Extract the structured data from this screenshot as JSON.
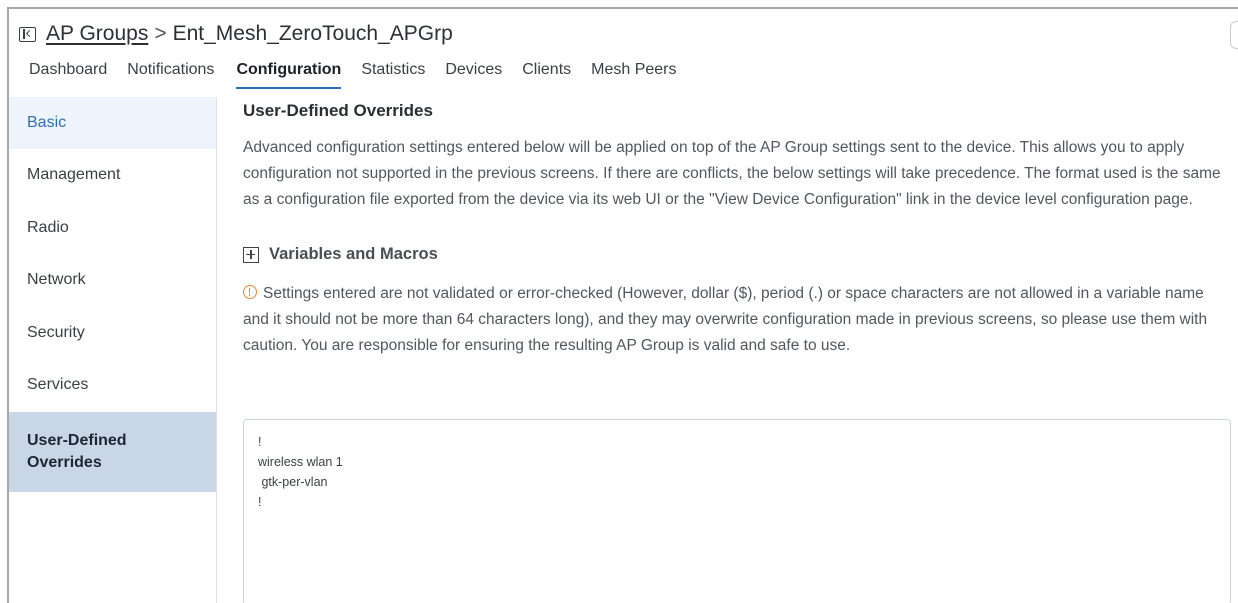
{
  "header": {
    "breadcrumb_root": "AP Groups",
    "breadcrumb_separator": ">",
    "breadcrumb_current": "Ent_Mesh_ZeroTouch_APGrp"
  },
  "tabs": [
    {
      "label": "Dashboard"
    },
    {
      "label": "Notifications"
    },
    {
      "label": "Configuration",
      "active": true
    },
    {
      "label": "Statistics"
    },
    {
      "label": "Devices"
    },
    {
      "label": "Clients"
    },
    {
      "label": "Mesh Peers"
    }
  ],
  "sidebar": {
    "items": [
      {
        "label": "Basic"
      },
      {
        "label": "Management"
      },
      {
        "label": "Radio"
      },
      {
        "label": "Network"
      },
      {
        "label": "Security"
      },
      {
        "label": "Services"
      },
      {
        "label": "User-Defined Overrides",
        "active": true
      }
    ]
  },
  "main": {
    "title": "User-Defined Overrides",
    "description": "Advanced configuration settings entered below will be applied on top of the AP Group settings sent to the device. This allows you to apply configuration not supported in the previous screens. If there are conflicts, the below settings will take precedence. The format used is the same as a configuration file exported from the device via its web UI or the \"View Device Configuration\" link in the device level configuration page.",
    "expander_label": "Variables and Macros",
    "warning": "Settings entered are not validated or error-checked (However, dollar ($), period (.) or space characters are not allowed in a variable name and it should not be more than 64 characters long), and they may overwrite configuration made in previous screens, so please use them with caution. You are responsible for ensuring the resulting AP Group is valid and safe to use.",
    "config_text": "!\nwireless wlan 1\n gtk-per-vlan\n!"
  },
  "colors": {
    "accent": "#2d6fb5",
    "sidebar_active_bg": "#c9d6e6",
    "warning": "#e8873a"
  },
  "icons": {
    "collapse": "sidebar-collapse-icon",
    "expand": "plus-box-icon",
    "warning": "warning-circle-icon"
  }
}
